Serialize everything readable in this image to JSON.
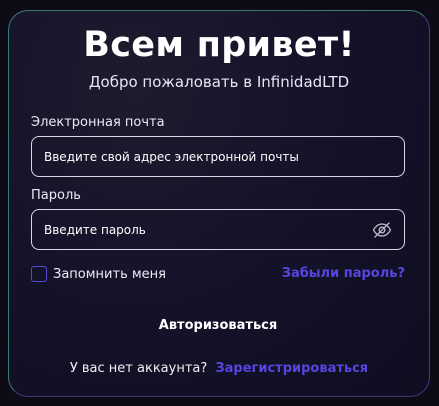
{
  "header": {
    "title": "Всем привет!",
    "subtitle": "Добро пожаловать в InfinidadLTD"
  },
  "form": {
    "email_label": "Электронная почта",
    "email_placeholder": "Введите свой адрес электронной почты",
    "email_value": "",
    "password_label": "Пароль",
    "password_placeholder": "Введите пароль",
    "password_value": "",
    "password_toggle_icon": "eye-off-icon",
    "remember_label": "Запомнить меня",
    "remember_checked": false,
    "forgot_link": "Забыли пароль?",
    "submit_label": "Авторизоваться"
  },
  "footer": {
    "no_account_text": "У вас нет аккаунта?",
    "register_link": "Зарегистрироваться"
  },
  "colors": {
    "accent": "#5a44e0",
    "background": "#0c0b16",
    "text": "#ffffff"
  }
}
